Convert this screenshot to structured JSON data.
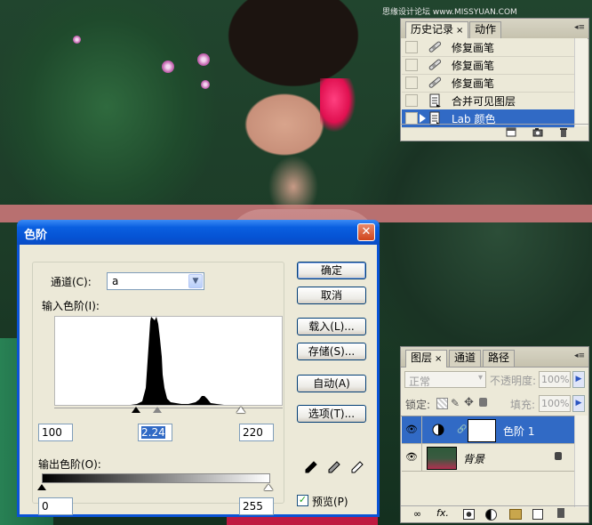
{
  "dialog": {
    "title": "色阶",
    "channel_label": "通道(C):",
    "channel_value": "a",
    "input_levels_label": "输入色阶(I):",
    "input_black": "100",
    "input_gamma": "2.24",
    "input_white": "220",
    "output_levels_label": "输出色阶(O):",
    "output_black": "0",
    "output_white": "255",
    "buttons": {
      "ok": "确定",
      "cancel": "取消",
      "load": "载入(L)...",
      "save": "存储(S)...",
      "auto": "自动(A)",
      "options": "选项(T)..."
    },
    "preview_label": "预览(P)",
    "preview_checked": true
  },
  "history_panel": {
    "tabs": [
      "历史记录",
      "动作"
    ],
    "items": [
      {
        "label": "修复画笔",
        "icon": "brush-icon"
      },
      {
        "label": "修复画笔",
        "icon": "brush-icon"
      },
      {
        "label": "修复画笔",
        "icon": "brush-icon"
      },
      {
        "label": "合并可见图层",
        "icon": "document-icon"
      },
      {
        "label": "Lab 颜色",
        "icon": "document-icon",
        "selected": true
      }
    ]
  },
  "layers_panel": {
    "tabs": [
      "图层",
      "通道",
      "路径"
    ],
    "blend_mode": "正常",
    "opacity_label": "不透明度:",
    "opacity_value": "100%",
    "lock_label": "锁定:",
    "fill_label": "填充:",
    "fill_value": "100%",
    "layers": [
      {
        "name": "色阶 1",
        "selected": true
      },
      {
        "name": "背景",
        "locked": true
      }
    ]
  },
  "watermark": "思缘设计论坛 www.MISSYUAN.COM",
  "colors": {
    "dialog_frame": "#0a53d6",
    "selection": "#316ac5",
    "panel_bg": "#ece9d8"
  }
}
